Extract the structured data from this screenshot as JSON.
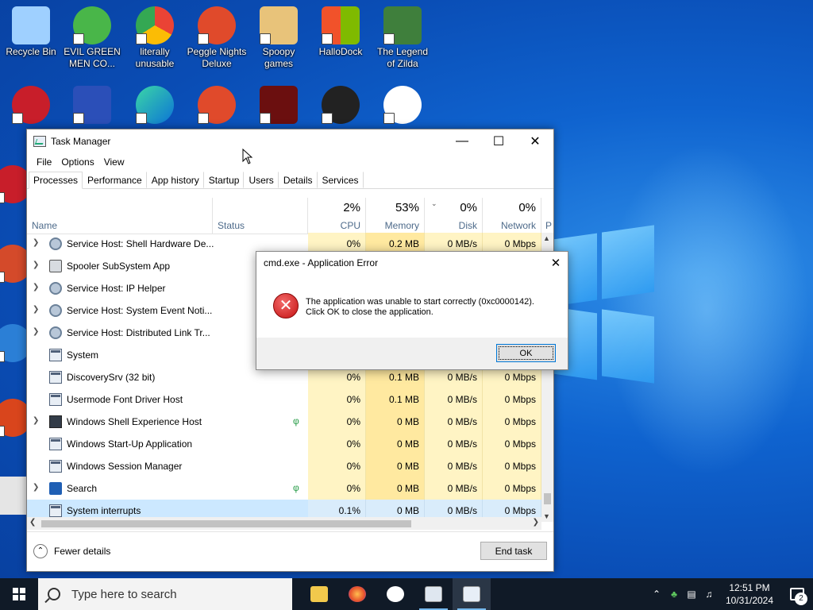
{
  "desktop_icons": [
    {
      "label": "Recycle Bin",
      "color": "#9fd0ff"
    },
    {
      "label": "EVIL GREEN MEN CO...",
      "color": "#49b649"
    },
    {
      "label": "literally unusable",
      "color": "#e3473b"
    },
    {
      "label": "Peggle Nights Deluxe",
      "color": "#e04a2b"
    },
    {
      "label": "Spoopy games",
      "color": "#e8c37a"
    },
    {
      "label": "HalloDock",
      "color": "#f1522a"
    },
    {
      "label": "The Legend of Zilda",
      "color": "#3f7f3c"
    }
  ],
  "task_manager": {
    "title": "Task Manager",
    "menu": [
      "File",
      "Options",
      "View"
    ],
    "tabs": [
      "Processes",
      "Performance",
      "App history",
      "Startup",
      "Users",
      "Details",
      "Services"
    ],
    "columns": {
      "name": "Name",
      "status": "Status",
      "cpu_pct": "2%",
      "cpu": "CPU",
      "mem_pct": "53%",
      "mem": "Memory",
      "disk_pct": "0%",
      "disk": "Disk",
      "net_pct": "0%",
      "net": "Network",
      "more": "P"
    },
    "rows": [
      {
        "name": "Service Host: Shell Hardware De...",
        "cpu": "0%",
        "mem": "0.2 MB",
        "disk": "0 MB/s",
        "net": "0 Mbps"
      },
      {
        "name": "Spooler SubSystem App",
        "cpu": "",
        "mem": "",
        "disk": "",
        "net": ""
      },
      {
        "name": "Service Host: IP Helper",
        "cpu": "",
        "mem": "",
        "disk": "",
        "net": ""
      },
      {
        "name": "Service Host: System Event Noti...",
        "cpu": "",
        "mem": "",
        "disk": "",
        "net": ""
      },
      {
        "name": "Service Host: Distributed Link Tr...",
        "cpu": "",
        "mem": "",
        "disk": "",
        "net": ""
      },
      {
        "name": "System",
        "cpu": "",
        "mem": "",
        "disk": "",
        "net": ""
      },
      {
        "name": "DiscoverySrv (32 bit)",
        "cpu": "0%",
        "mem": "0.1 MB",
        "disk": "0 MB/s",
        "net": "0 Mbps"
      },
      {
        "name": "Usermode Font Driver Host",
        "cpu": "0%",
        "mem": "0.1 MB",
        "disk": "0 MB/s",
        "net": "0 Mbps"
      },
      {
        "name": "Windows Shell Experience Host",
        "cpu": "0%",
        "mem": "0 MB",
        "disk": "0 MB/s",
        "net": "0 Mbps"
      },
      {
        "name": "Windows Start-Up Application",
        "cpu": "0%",
        "mem": "0 MB",
        "disk": "0 MB/s",
        "net": "0 Mbps"
      },
      {
        "name": "Windows Session Manager",
        "cpu": "0%",
        "mem": "0 MB",
        "disk": "0 MB/s",
        "net": "0 Mbps"
      },
      {
        "name": "Search",
        "cpu": "0%",
        "mem": "0 MB",
        "disk": "0 MB/s",
        "net": "0 Mbps"
      },
      {
        "name": "System interrupts",
        "cpu": "0.1%",
        "mem": "0 MB",
        "disk": "0 MB/s",
        "net": "0 Mbps"
      }
    ],
    "fewer_details": "Fewer details",
    "end_task": "End task"
  },
  "dialog": {
    "title": "cmd.exe - Application Error",
    "message_line1": "The application was unable to start correctly (0xc0000142).",
    "message_line2": "Click OK to close the application.",
    "ok": "OK"
  },
  "taskbar": {
    "search_placeholder": "Type here to search",
    "time": "12:51 PM",
    "date": "10/31/2024",
    "notification_count": "2"
  }
}
